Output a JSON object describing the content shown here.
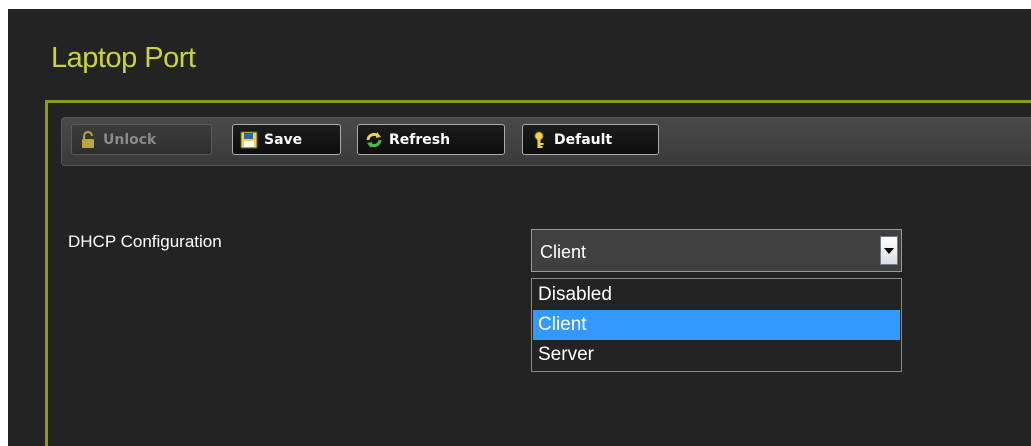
{
  "page": {
    "title": "Laptop Port"
  },
  "toolbar": {
    "buttons": [
      {
        "label": "Unlock",
        "icon": "lock-icon",
        "disabled": true
      },
      {
        "label": "Save",
        "icon": "floppy-icon",
        "disabled": false
      },
      {
        "label": "Refresh",
        "icon": "refresh-icon",
        "disabled": false
      },
      {
        "label": "Default",
        "icon": "key-icon",
        "disabled": false
      }
    ]
  },
  "form": {
    "dhcp": {
      "label": "DHCP Configuration",
      "selected": "Client",
      "options": [
        "Disabled",
        "Client",
        "Server"
      ]
    }
  },
  "colors": {
    "accent": "#c9d43c",
    "border_accent": "#8f9a1c",
    "selection": "#3399ff",
    "background": "#232323"
  }
}
